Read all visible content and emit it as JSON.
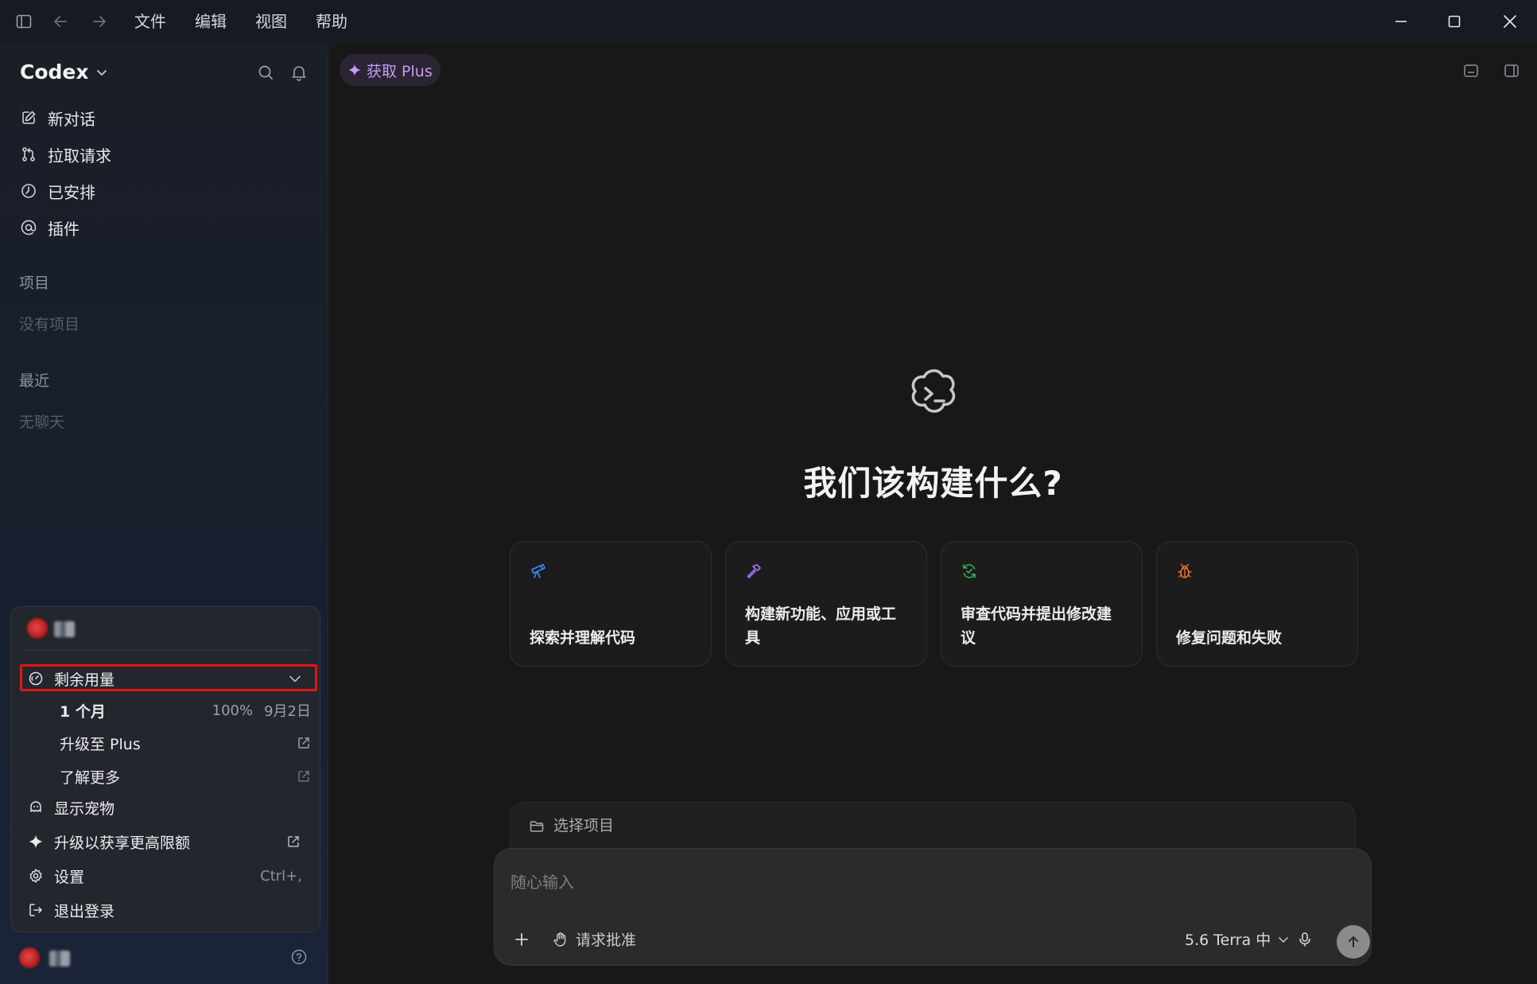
{
  "titlebar": {
    "menu": [
      "文件",
      "编辑",
      "视图",
      "帮助"
    ]
  },
  "sidebar": {
    "brand": "Codex",
    "nav": [
      {
        "label": "新对话",
        "icon": "edit-icon"
      },
      {
        "label": "拉取请求",
        "icon": "pull-request-icon"
      },
      {
        "label": "已安排",
        "icon": "clock-icon"
      },
      {
        "label": "插件",
        "icon": "at-icon"
      }
    ],
    "projects_title": "项目",
    "projects_empty": "没有项目",
    "recent_title": "最近",
    "recent_empty": "无聊天"
  },
  "popup": {
    "usage_label": "剩余用量",
    "period_label": "1 个月",
    "period_percent": "100%",
    "period_reset": "9月2日",
    "upgrade_plus": "升级至 Plus",
    "learn_more": "了解更多",
    "show_pet": "显示宠物",
    "upgrade_limits": "升级以获享更高限额",
    "settings": "设置",
    "settings_shortcut": "Ctrl+,",
    "logout": "退出登录"
  },
  "main": {
    "plus_badge": "获取 Plus",
    "hero_title": "我们该构建什么?",
    "cards": [
      {
        "label": "探索并理解代码",
        "icon": "telescope-icon",
        "color": "#3b8cff"
      },
      {
        "label": "构建新功能、应用或工具",
        "icon": "hammer-icon",
        "color": "#a872f5"
      },
      {
        "label": "审查代码并提出修改建议",
        "icon": "review-icon",
        "color": "#2fb35a"
      },
      {
        "label": "修复问题和失败",
        "icon": "bug-icon",
        "color": "#f0722c"
      }
    ],
    "project_select": "选择项目",
    "composer": {
      "placeholder": "随心输入",
      "approve_label": "请求批准",
      "model_label": "5.6 Terra 中"
    }
  },
  "colors": {
    "highlight": "#e01414",
    "plus_accent": "#c49cf5"
  }
}
